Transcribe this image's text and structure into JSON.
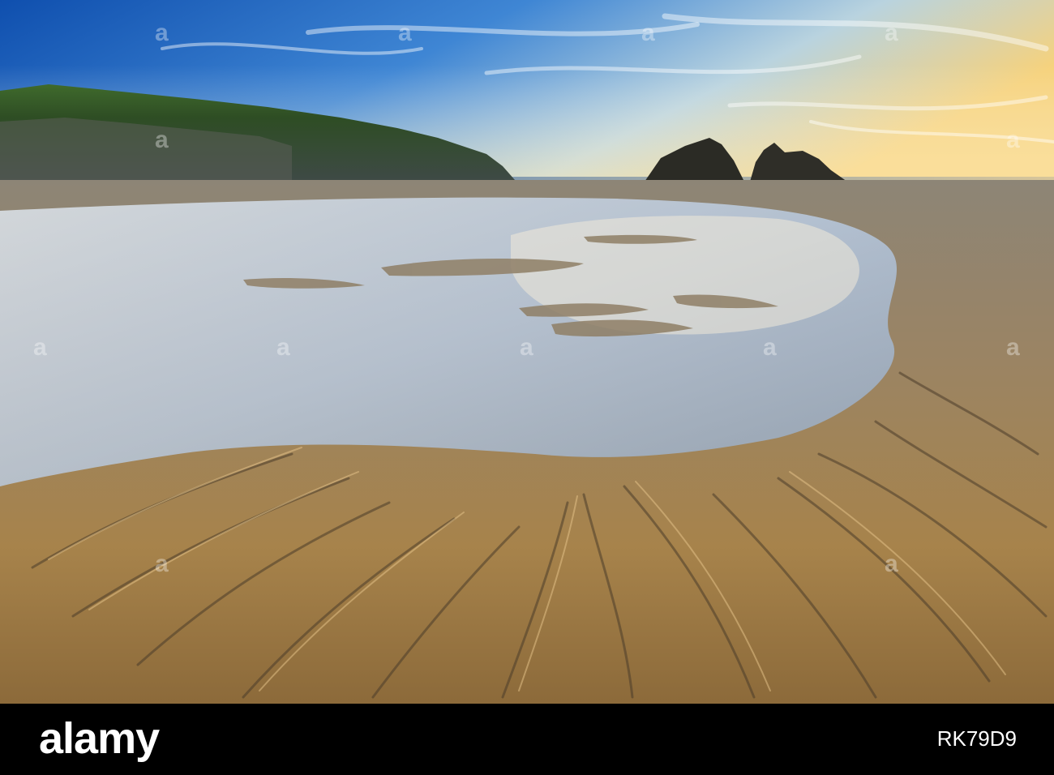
{
  "footer": {
    "brand": "alamy",
    "image_id": "RK79D9"
  },
  "watermark": {
    "text": "a"
  },
  "colors": {
    "sky_top": "#1f5fb8",
    "sky_horizon": "#f3d58a",
    "cliff": "#2f4b22",
    "stacks": "#2b2b25",
    "sand": "#9a7a4a",
    "water": "#c9d9ee",
    "bar": "#000000"
  }
}
